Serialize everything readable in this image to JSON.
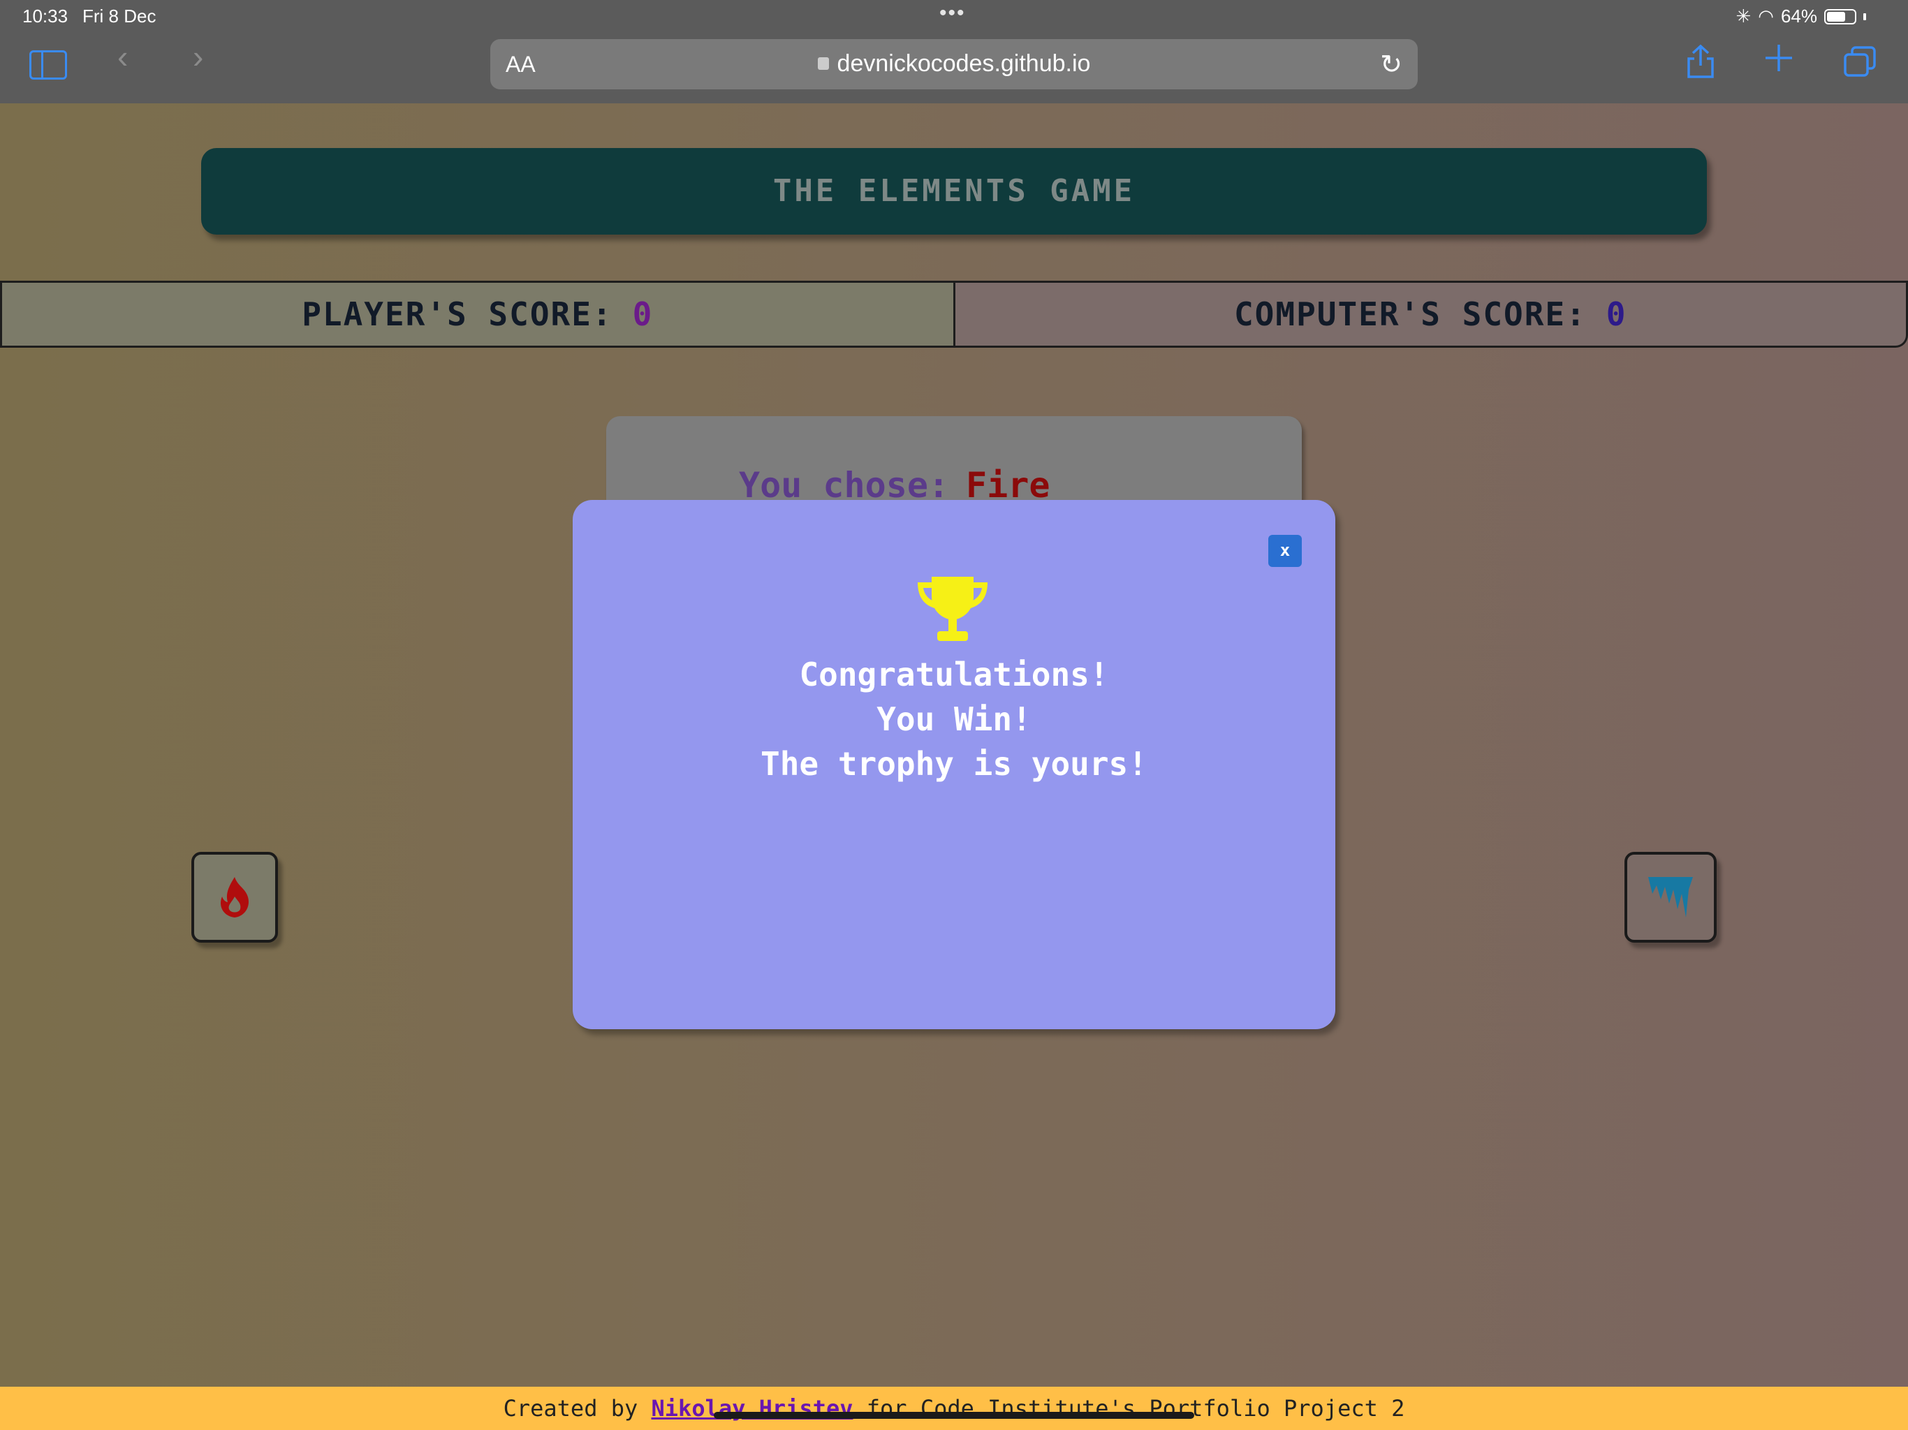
{
  "status_bar": {
    "time": "10:33",
    "date": "Fri 8 Dec",
    "dots": "•••",
    "battery": "64%"
  },
  "browser": {
    "text_size_label": "AA",
    "url": "devnickocodes.github.io"
  },
  "game": {
    "title": "THE ELEMENTS GAME",
    "player_score_label": "PLAYER'S SCORE:",
    "player_score": "0",
    "computer_score_label": "COMPUTER'S SCORE:",
    "computer_score": "0",
    "result_prefix": "You chose:",
    "result_choice": "Fire"
  },
  "modal": {
    "close_label": "x",
    "line1": "Congratulations!",
    "line2": "You Win!",
    "line3": "The trophy is yours!"
  },
  "footer": {
    "prefix": "Created by",
    "author": "Nikolay Hristev",
    "suffix": "for Code Institute's Portfolio Project 2"
  },
  "colors": {
    "title_bg": "#0f3b3c",
    "modal_bg": "#9497ee",
    "footer_bg": "#ffbf47",
    "fire": "#b00d0d",
    "ice": "#1779a3",
    "trophy": "#f6f016"
  }
}
